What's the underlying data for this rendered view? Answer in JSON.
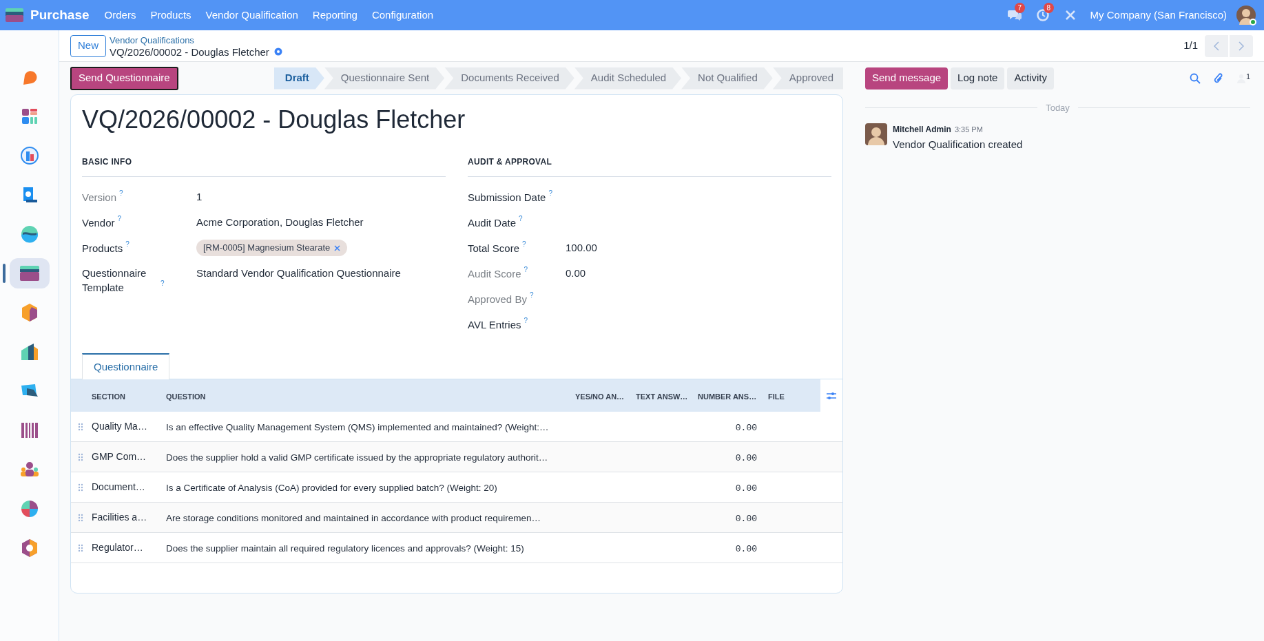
{
  "navbar": {
    "app": "Purchase",
    "menus": [
      "Orders",
      "Products",
      "Vendor Qualification",
      "Reporting",
      "Configuration"
    ],
    "messages_badge": "7",
    "activities_badge": "8",
    "company": "My Company (San Francisco)",
    "user_online": true
  },
  "sidebar": {
    "apps": [
      {
        "selected": false
      },
      {
        "selected": false
      },
      {
        "selected": false
      },
      {
        "selected": false
      },
      {
        "selected": false
      },
      {
        "selected": true
      },
      {
        "selected": false
      },
      {
        "selected": false
      },
      {
        "selected": false
      },
      {
        "selected": false
      },
      {
        "selected": false
      },
      {
        "selected": false
      },
      {
        "selected": false
      }
    ]
  },
  "control_panel": {
    "new_button": "New",
    "breadcrumb": "Vendor Qualifications",
    "record": "VQ/2026/00002 - Douglas Fletcher",
    "pager": "1/1"
  },
  "action_button": "Send Questionnaire",
  "stages": [
    {
      "label": "Draft",
      "selected": true
    },
    {
      "label": "Questionnaire Sent",
      "selected": false
    },
    {
      "label": "Documents Received",
      "selected": false
    },
    {
      "label": "Audit Scheduled",
      "selected": false
    },
    {
      "label": "Not Qualified",
      "selected": false
    },
    {
      "label": "Approved",
      "selected": false
    }
  ],
  "form": {
    "title": "VQ/2026/00002 - Douglas Fletcher",
    "groups": [
      {
        "heading": "BASIC INFO",
        "fields": [
          {
            "label": "Version",
            "help": "?",
            "readonly": true,
            "value": "1"
          },
          {
            "label": "Vendor",
            "help": "?",
            "readonly": false,
            "value": "Acme Corporation, Douglas Fletcher"
          },
          {
            "label": "Products",
            "help": "?",
            "readonly": false,
            "tags": [
              "[RM-0005] Magnesium Stearate"
            ]
          },
          {
            "label": "Questionnaire Template",
            "help": "?",
            "readonly": false,
            "value": "Standard Vendor Qualification Questionnaire"
          }
        ]
      },
      {
        "heading": "AUDIT & APPROVAL",
        "fields": [
          {
            "label": "Submission Date",
            "help": "?",
            "readonly": false
          },
          {
            "label": "Audit Date",
            "help": "?",
            "readonly": false
          },
          {
            "label": "Total Score",
            "help": "?",
            "readonly": false,
            "value": "100.00"
          },
          {
            "label": "Audit Score",
            "help": "?",
            "readonly": true,
            "value": "0.00"
          },
          {
            "label": "Approved By",
            "help": "?",
            "readonly": true
          },
          {
            "label": "AVL Entries",
            "help": "?",
            "readonly": false
          }
        ]
      }
    ],
    "tabs": [
      {
        "label": "Questionnaire",
        "selected": true
      }
    ],
    "table": {
      "columns": [
        "SECTION",
        "QUESTION",
        "YES/NO AN…",
        "TEXT ANSW…",
        "NUMBER ANS…",
        "FILE"
      ],
      "rows": [
        {
          "section": "Quality Ma…",
          "question": "Is an effective Quality Management System (QMS) implemented and maintained? (Weight:…",
          "number": "0.00"
        },
        {
          "section": "GMP Com…",
          "question": "Does the supplier hold a valid GMP certificate issued by the appropriate regulatory authorit…",
          "number": "0.00"
        },
        {
          "section": "Document…",
          "question": "Is a Certificate of Analysis (CoA) provided for every supplied batch? (Weight: 20)",
          "number": "0.00"
        },
        {
          "section": "Facilities a…",
          "question": "Are storage conditions monitored and maintained in accordance with product requiremen…",
          "number": "0.00"
        },
        {
          "section": "Regulator…",
          "question": "Does the supplier maintain all required regulatory licences and approvals? (Weight: 15)",
          "number": "0.00"
        }
      ]
    }
  },
  "chatter": {
    "buttons": [
      "Send message",
      "Log note",
      "Activity"
    ],
    "followers": "1",
    "date_separator": "Today",
    "messages": [
      {
        "author": "Mitchell Admin",
        "time": "3:35 PM",
        "body": "Vendor Qualification created"
      }
    ]
  }
}
